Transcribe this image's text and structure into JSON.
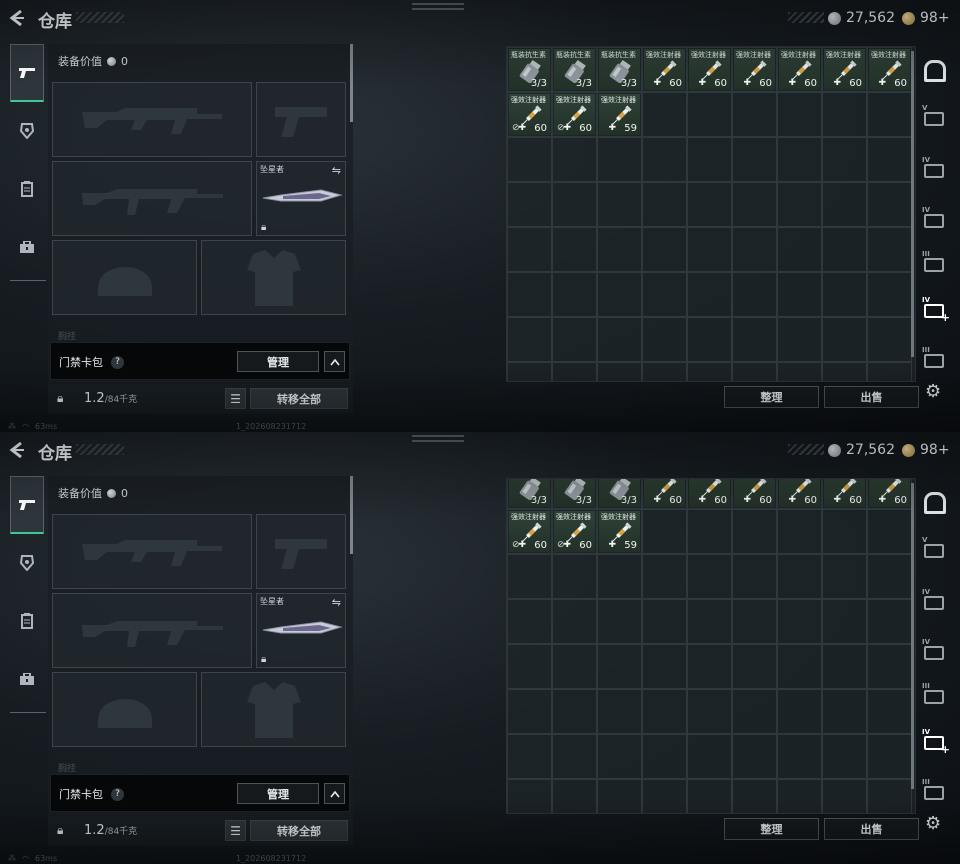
{
  "header": {
    "title": "仓库",
    "currency_silver": "27,562",
    "currency_bond": "98+"
  },
  "loadout": {
    "equipment_value_label": "装备价值",
    "equipment_value": "0",
    "melee_name": "坠星者",
    "faded_label": "胸挂",
    "card_pack_label": "门禁卡包",
    "help_symbol": "?",
    "manage_button": "管理",
    "weight_value": "1.2",
    "weight_capacity": "/84千克",
    "transfer_all_button": "转移全部"
  },
  "storage": {
    "items": [
      {
        "name": "瓶装抗生素",
        "qty": "3/3",
        "type": "bottle"
      },
      {
        "name": "瓶装抗生素",
        "qty": "3/3",
        "type": "bottle"
      },
      {
        "name": "瓶装抗生素",
        "qty": "3/3",
        "type": "bottle"
      },
      {
        "name": "强效注射器",
        "qty": "60",
        "type": "syringe"
      },
      {
        "name": "强效注射器",
        "qty": "60",
        "type": "syringe"
      },
      {
        "name": "强效注射器",
        "qty": "60",
        "type": "syringe"
      },
      {
        "name": "强效注射器",
        "qty": "60",
        "type": "syringe"
      },
      {
        "name": "强效注射器",
        "qty": "60",
        "type": "syringe"
      },
      {
        "name": "强效注射器",
        "qty": "60",
        "type": "syringe"
      },
      {
        "name": "强效注射器",
        "qty": "60",
        "type": "syringe",
        "nodisc": true
      },
      {
        "name": "强效注射器",
        "qty": "60",
        "type": "syringe",
        "nodisc": true
      },
      {
        "name": "强效注射器",
        "qty": "59",
        "type": "syringe"
      }
    ],
    "sort_button": "整理",
    "sell_button": "出售"
  },
  "right_rail": {
    "labels": [
      "V",
      "IV",
      "IV",
      "III",
      "IV",
      "III"
    ]
  },
  "status": {
    "ping": "63ms",
    "build": "1_202608231712"
  },
  "colors": {
    "accent": "#41c59b",
    "item_bg": "#2f4236"
  }
}
